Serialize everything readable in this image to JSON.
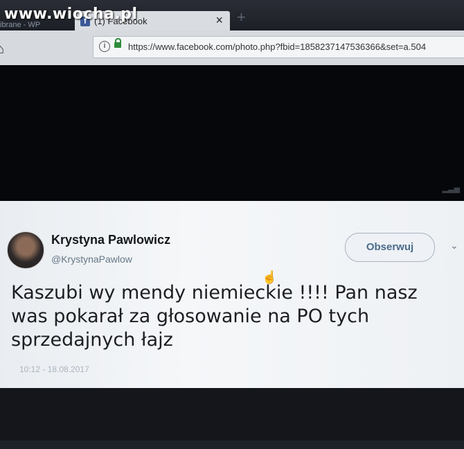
{
  "watermark": "www.wiocha.pl",
  "browser": {
    "prev_tab_label": "ibrane - WP",
    "active_tab_title": "(1) Facebook",
    "close_glyph": "×",
    "new_tab_glyph": "+",
    "url": "https://www.facebook.com/photo.php?fbid=1858237147536366&set=a.504"
  },
  "tweet": {
    "display_name": "Krystyna Pawlowicz",
    "handle": "@KrystynaPawlow",
    "follow_label": "Obserwuj",
    "text": "Kaszubi wy mendy niemieckie !!!! Pan nasz was pokarał za głosowanie na PO tych sprzedajnych łajz",
    "timestamp": "10:12 - 18.08.2017"
  },
  "icons": {
    "facebook": "facebook-icon",
    "info": "info-icon",
    "lock": "lock-icon",
    "home": "home-icon",
    "chevron": "chevron-down-icon",
    "cursor": "hand-cursor-icon"
  }
}
